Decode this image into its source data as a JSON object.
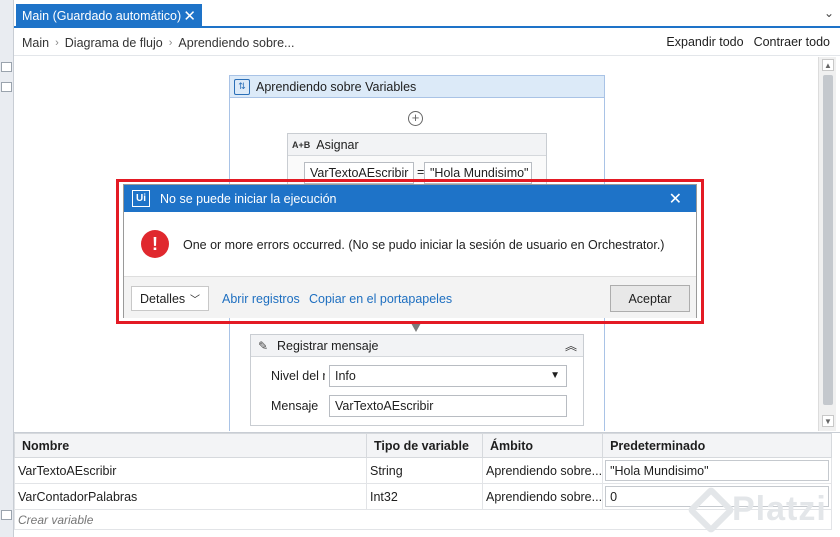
{
  "tab": {
    "title": "Main (Guardado automático)",
    "close_glyph": "✕",
    "menu_glyph": "⌄"
  },
  "breadcrumb": {
    "items": [
      "Main",
      "Diagrama de flujo",
      "Aprendiendo sobre..."
    ],
    "separator": "›",
    "expand_all": "Expandir todo",
    "collapse_all": "Contraer todo"
  },
  "sequence": {
    "title": "Aprendiendo sobre Variables",
    "add_glyph": "+"
  },
  "assign": {
    "title": "Asignar",
    "icon_text": "A+B",
    "to_value": "VarTextoAEscribir",
    "equals": "=",
    "value": "\"Hola Mundisimo\""
  },
  "log_message": {
    "title": "Registrar mensaje",
    "level_label": "Nivel del r",
    "level_value": "Info",
    "message_label": "Mensaje",
    "message_value": "VarTextoAEscribir"
  },
  "dialog": {
    "title": "No se puede iniciar la ejecución",
    "logo_text": "Ui",
    "message": "One or more errors occurred. (No se pudo iniciar la sesión de usuario en Orchestrator.)",
    "details_label": "Detalles",
    "open_logs": "Abrir registros",
    "copy_clipboard": "Copiar en el portapapeles",
    "accept": "Aceptar"
  },
  "variables": {
    "columns": [
      "Nombre",
      "Tipo de variable",
      "Ámbito",
      "Predeterminado"
    ],
    "rows": [
      {
        "name": "VarTextoAEscribir",
        "type": "String",
        "scope": "Aprendiendo sobre...",
        "default": "\"Hola Mundisimo\""
      },
      {
        "name": "VarContadorPalabras",
        "type": "Int32",
        "scope": "Aprendiendo sobre...",
        "default": "0"
      }
    ],
    "create_label": "Crear variable"
  },
  "watermark": {
    "text": "Platzi"
  },
  "colors": {
    "accent": "#1e73c8",
    "error": "#e0282e",
    "highlight_frame": "#e31a24"
  }
}
